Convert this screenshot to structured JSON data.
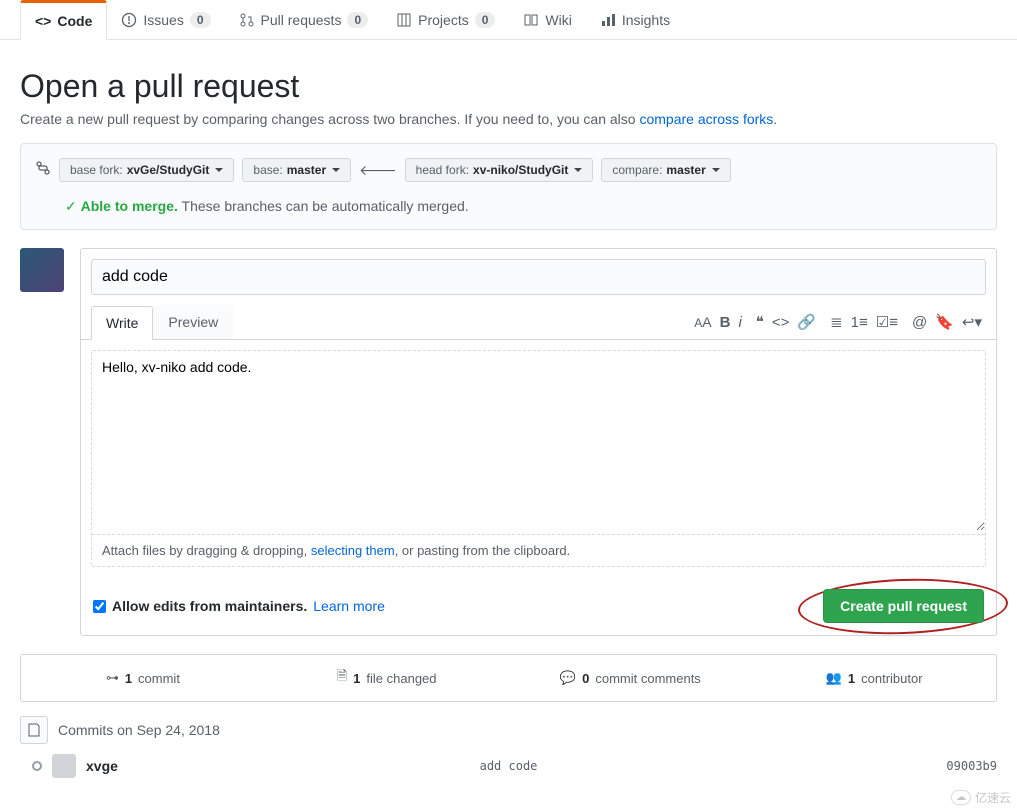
{
  "tabs": {
    "code": "Code",
    "issues": "Issues",
    "issues_count": "0",
    "pulls": "Pull requests",
    "pulls_count": "0",
    "projects": "Projects",
    "projects_count": "0",
    "wiki": "Wiki",
    "insights": "Insights"
  },
  "heading": "Open a pull request",
  "subtitle_pre": "Create a new pull request by comparing changes across two branches. If you need to, you can also ",
  "subtitle_link": "compare across forks",
  "subtitle_post": ".",
  "compare": {
    "base_fork_label": "base fork:",
    "base_fork_value": "xvGe/StudyGit",
    "base_label": "base:",
    "base_value": "master",
    "head_fork_label": "head fork:",
    "head_fork_value": "xv-niko/StudyGit",
    "compare_label": "compare:",
    "compare_value": "master"
  },
  "merge_status": {
    "able": "Able to merge.",
    "note": "These branches can be automatically merged."
  },
  "form": {
    "title": "add code",
    "write_tab": "Write",
    "preview_tab": "Preview",
    "body": "Hello, xv-niko add code.",
    "attach_pre": "Attach files by dragging & dropping, ",
    "attach_link": "selecting them",
    "attach_post": ", or pasting from the clipboard.",
    "allow_edits": "Allow edits from maintainers.",
    "learn_more": "Learn more",
    "submit": "Create pull request"
  },
  "stats": {
    "commits_count": "1",
    "commits_label": "commit",
    "files_count": "1",
    "files_label": "file changed",
    "comments_count": "0",
    "comments_label": "commit comments",
    "contrib_count": "1",
    "contrib_label": "contributor"
  },
  "commits": {
    "heading": "Commits on Sep 24, 2018",
    "author": "xvge",
    "message": "add code",
    "sha": "09003b9"
  },
  "watermark": "亿速云"
}
